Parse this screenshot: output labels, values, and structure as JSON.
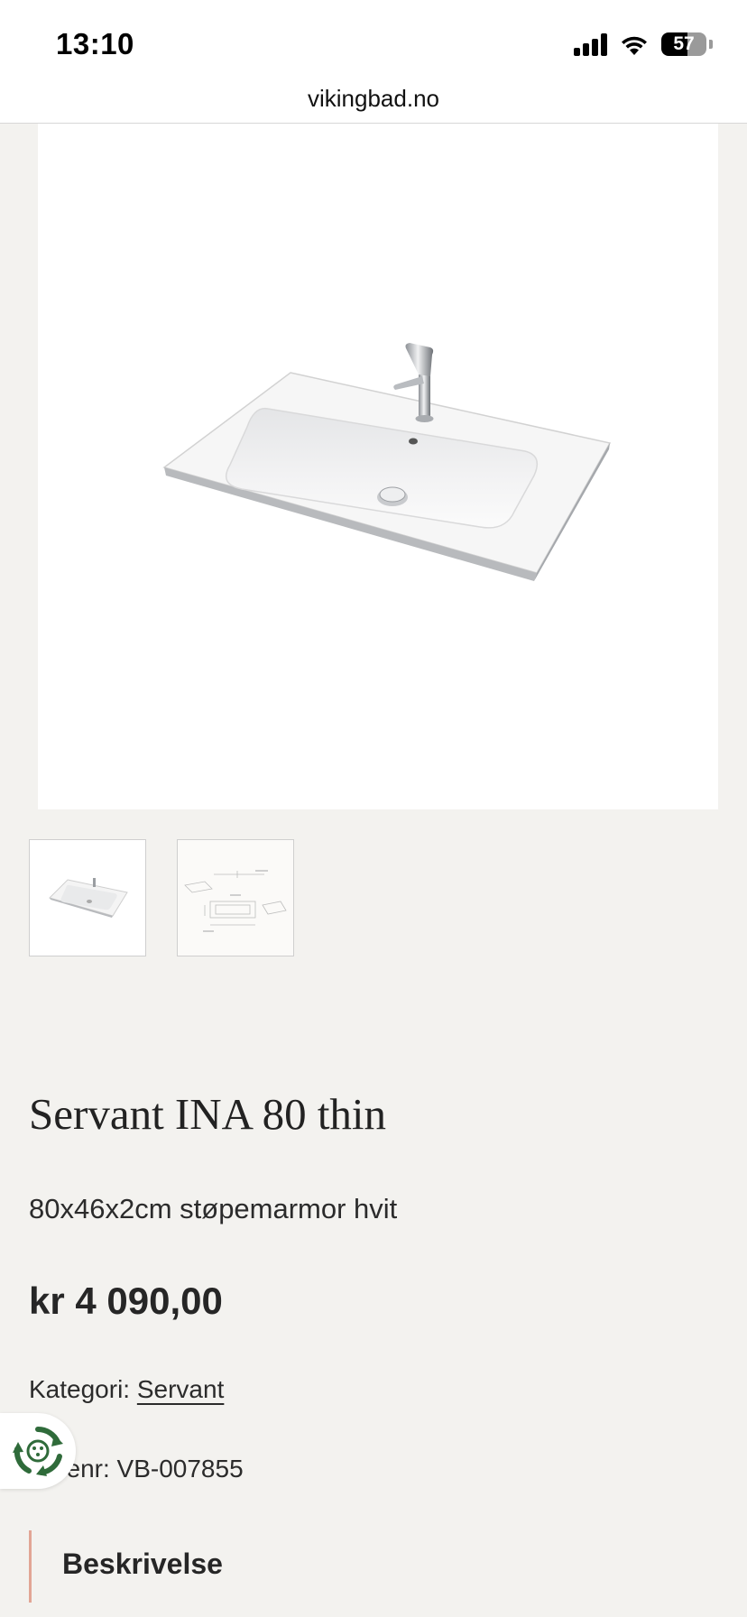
{
  "status_bar": {
    "time": "13:10",
    "battery_level": "57",
    "icons": [
      "signal-icon",
      "wifi-icon",
      "battery-icon"
    ]
  },
  "browser": {
    "url": "vikingbad.no"
  },
  "gallery": {
    "main_image": "sink-image",
    "thumbnails": [
      "sink-thumbnail",
      "technical-drawing-thumbnail"
    ]
  },
  "product": {
    "title": "Servant INA 80 thin",
    "subtitle": "80x46x2cm støpemarmor hvit",
    "price": "kr 4 090,00",
    "category_label": "Kategori:",
    "category_value": "Servant",
    "sku_label": "Varenr:",
    "sku_value": "VB-007855"
  },
  "eco_widget": {
    "icon": "recycle-icon",
    "color": "#2f6b3a"
  },
  "description": {
    "heading": "Beskrivelse",
    "accent_color": "#e2a595"
  }
}
